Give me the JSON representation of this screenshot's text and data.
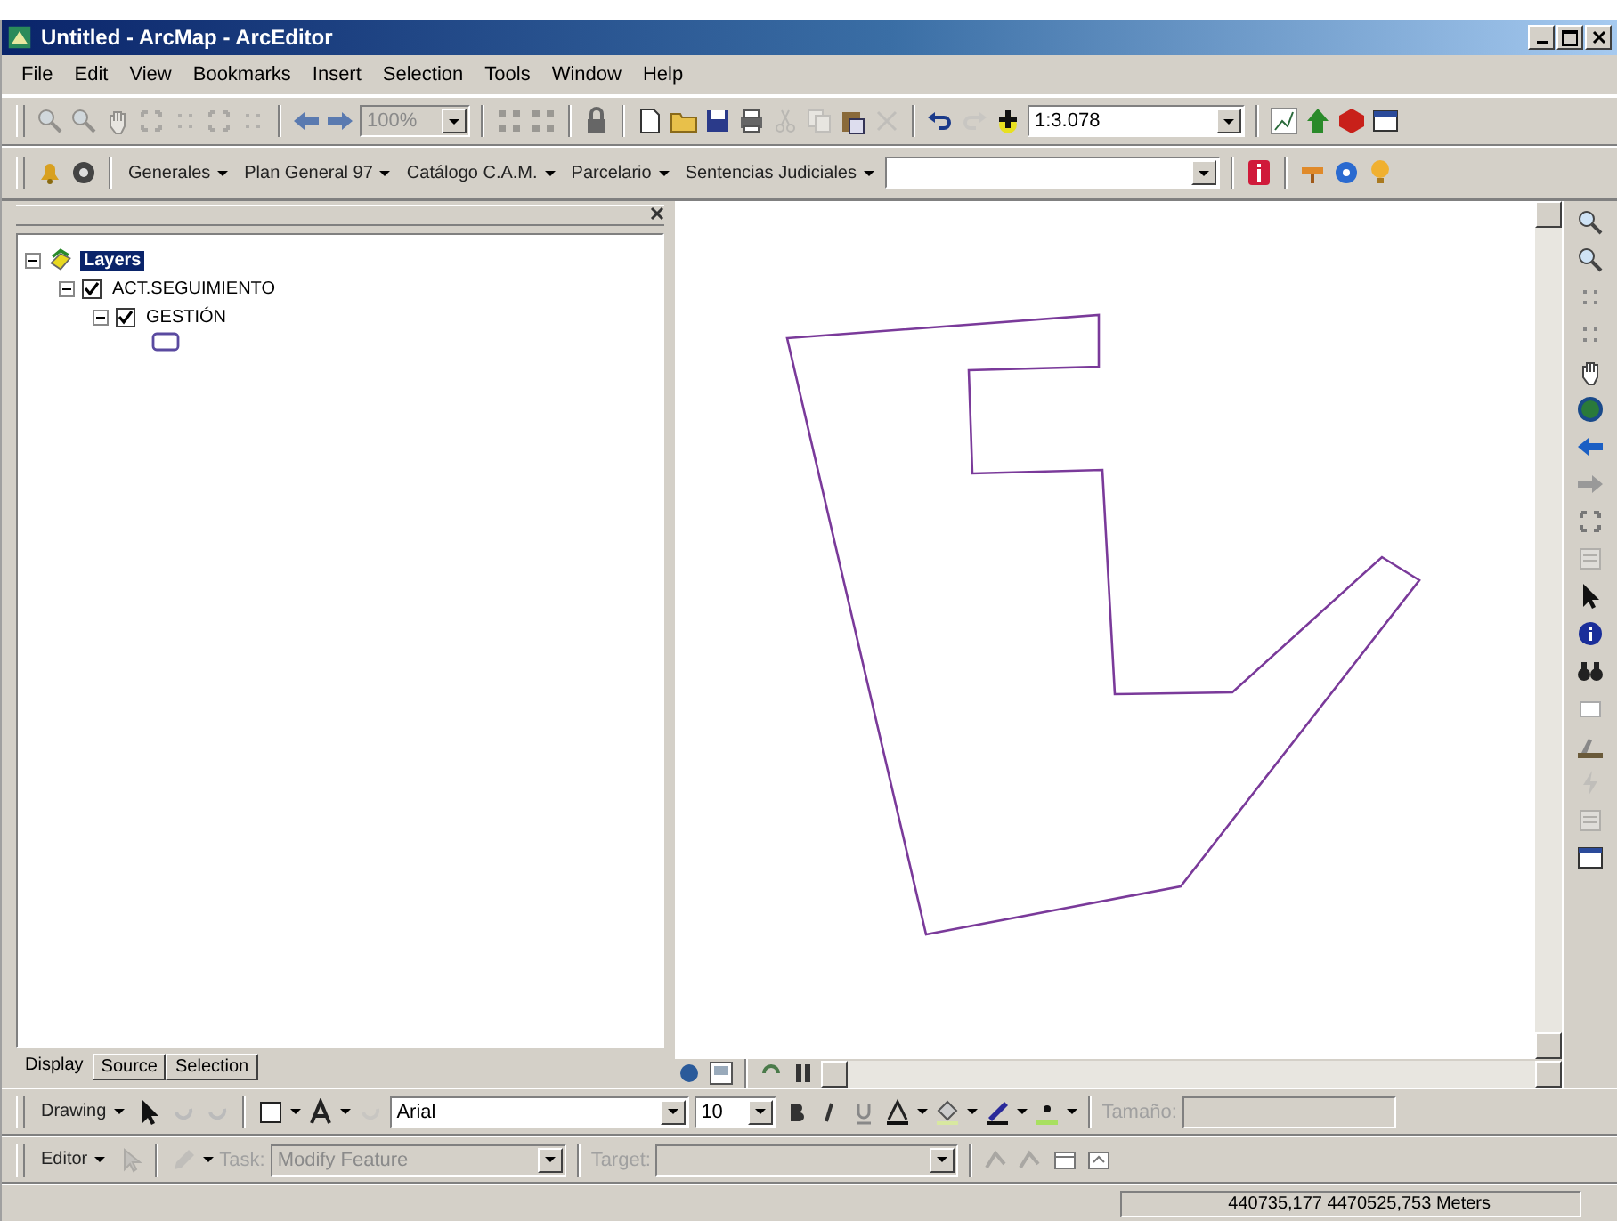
{
  "window": {
    "title": "Untitled - ArcMap - ArcEditor"
  },
  "menu_bar": [
    "File",
    "Edit",
    "View",
    "Bookmarks",
    "Insert",
    "Selection",
    "Tools",
    "Window",
    "Help"
  ],
  "standard_toolbar": {
    "zoom_combo": {
      "value": "100%",
      "disabled": true
    },
    "scale_combo": {
      "value": "1:3.078",
      "disabled": false
    }
  },
  "custom_toolbar": {
    "menus": [
      "Generales",
      "Plan General 97",
      "Catálogo C.A.M.",
      "Parcelario",
      "Sentencias Judiciales"
    ]
  },
  "table_of_contents": {
    "tree": [
      {
        "kind": "data_frame",
        "label": "Layers",
        "selected": true,
        "expanded": true,
        "children": [
          {
            "kind": "layer",
            "label": "ACT.SEGUIMIENTO",
            "selected": false,
            "checked": true,
            "expanded": true,
            "children": [
              {
                "kind": "layer",
                "label": "GESTIÓN",
                "selected": false,
                "checked": true,
                "expanded": true
              }
            ]
          }
        ]
      }
    ],
    "tabs": [
      {
        "label": "Display",
        "selected": true
      },
      {
        "label": "Source",
        "selected": false
      },
      {
        "label": "Selection",
        "selected": false
      }
    ]
  },
  "drawing_toolbar": {
    "label": "Drawing",
    "font": "Arial",
    "font_size": "10",
    "size_label": {
      "text": "Tamaño:",
      "disabled": true
    }
  },
  "editor_toolbar": {
    "label": "Editor",
    "task": {
      "label": "Task:",
      "value": "Modify Feature",
      "disabled": true
    },
    "target": {
      "label": "Target:",
      "disabled": true
    }
  },
  "status_bar": {
    "coordinates": "440735,177  4470525,753 Meters"
  }
}
